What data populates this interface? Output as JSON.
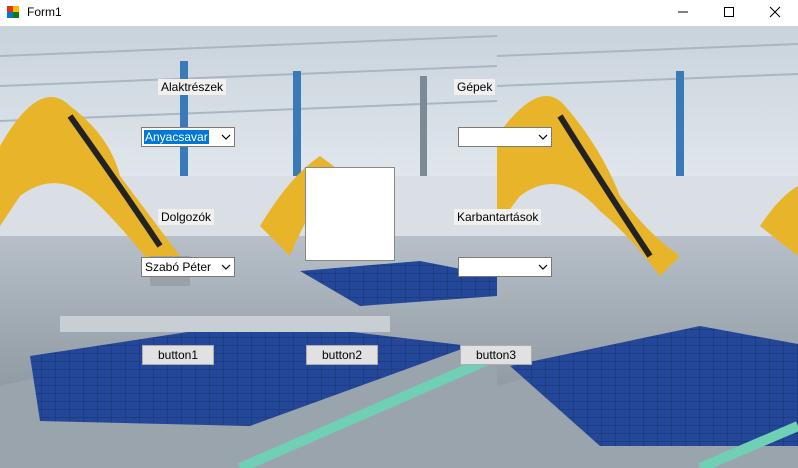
{
  "window": {
    "title": "Form1"
  },
  "labels": {
    "parts": "Alaktrészek",
    "machines": "Gépek",
    "workers": "Dolgozók",
    "maintenance": "Karbantartások"
  },
  "combos": {
    "parts": {
      "value": "Anyacsavar"
    },
    "machines": {
      "value": ""
    },
    "workers": {
      "value": "Szabó Péter"
    },
    "maintenance": {
      "value": ""
    }
  },
  "buttons": {
    "button1": "button1",
    "button2": "button2",
    "button3": "button3"
  },
  "icons": {
    "app": "form-app-icon",
    "minimize": "minimize-icon",
    "maximize": "maximize-icon",
    "close": "close-icon"
  },
  "colors": {
    "selection": "#0078d7",
    "label_bg": "#f0f0f0",
    "button_bg": "#e1e1e1",
    "robot_yellow": "#e8b52a",
    "panel_blue": "#1e3f86"
  }
}
